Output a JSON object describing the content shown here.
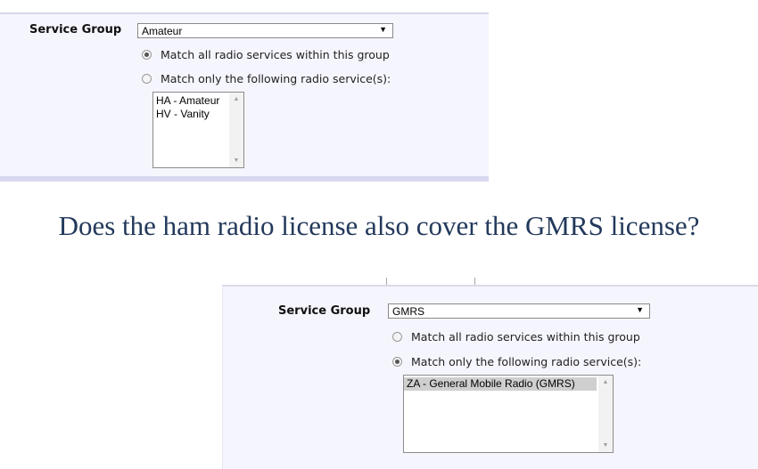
{
  "top_form": {
    "service_group_label": "Service Group",
    "service_group_value": "Amateur",
    "radio_all_label": "Match all radio services within this group",
    "radio_only_label": "Match only the following radio service(s):",
    "selected_radio": "all",
    "services": [
      "HA - Amateur",
      "HV - Vanity"
    ]
  },
  "question": "Does the ham radio license also cover the GMRS license?",
  "bottom_form": {
    "service_group_label": "Service Group",
    "service_group_value": "GMRS",
    "radio_all_label": "Match all radio services within this group",
    "radio_only_label": "Match only the following radio service(s):",
    "selected_radio": "only",
    "services": [
      "ZA - General Mobile Radio (GMRS)"
    ],
    "selected_service": "ZA - General Mobile Radio (GMRS)"
  },
  "icons": {
    "dropdown_arrow": "▼",
    "scroll_up": "▲",
    "scroll_down": "▼"
  }
}
